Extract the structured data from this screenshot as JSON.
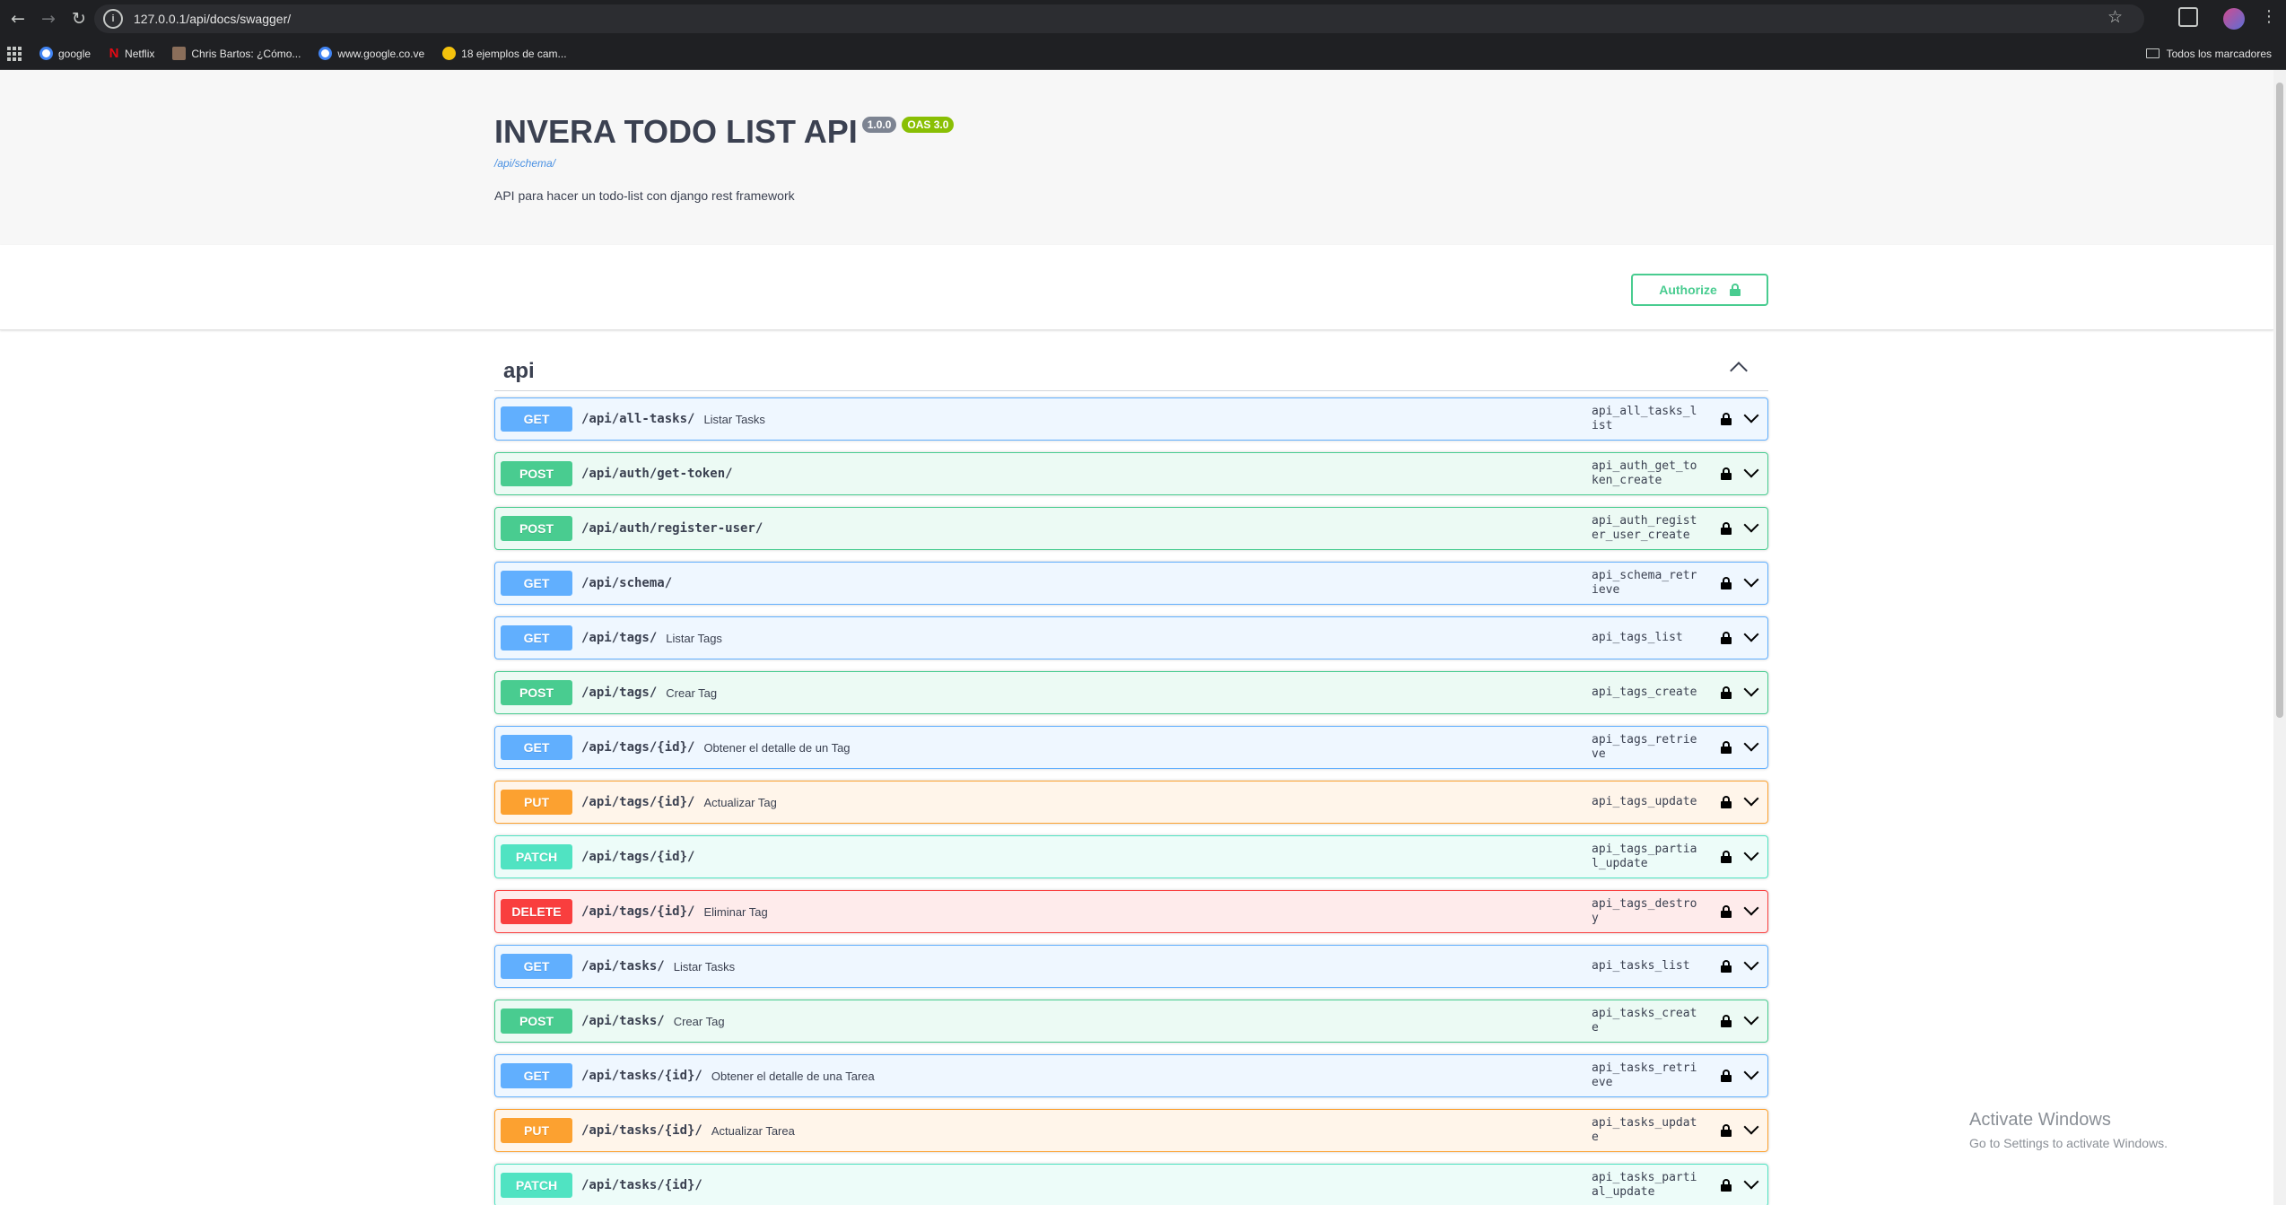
{
  "browser": {
    "url": "127.0.0.1/api/docs/swagger/",
    "bookmarks": [
      {
        "label": "google",
        "icon": "google-icon"
      },
      {
        "label": "Netflix",
        "icon": "netflix-icon"
      },
      {
        "label": "Chris Bartos: ¿Cómo...",
        "icon": "page-icon"
      },
      {
        "label": "www.google.co.ve",
        "icon": "google-icon"
      },
      {
        "label": "18 ejemplos de cam...",
        "icon": "page-icon"
      }
    ],
    "all_bookmarks_label": "Todos los marcadores"
  },
  "info": {
    "title": "INVERA TODO LIST API",
    "version": "1.0.0",
    "oas": "OAS 3.0",
    "schema_link": "/api/schema/",
    "description": "API para hacer un todo-list con django rest framework"
  },
  "authorize_label": "Authorize",
  "tag": {
    "name": "api"
  },
  "operations": [
    {
      "method": "GET",
      "path": "/api/all-tasks/",
      "summary": "Listar Tasks",
      "operation_id": "api_all_tasks_list"
    },
    {
      "method": "POST",
      "path": "/api/auth/get-token/",
      "summary": "",
      "operation_id": "api_auth_get_token_create"
    },
    {
      "method": "POST",
      "path": "/api/auth/register-user/",
      "summary": "",
      "operation_id": "api_auth_register_user_create"
    },
    {
      "method": "GET",
      "path": "/api/schema/",
      "summary": "",
      "operation_id": "api_schema_retrieve"
    },
    {
      "method": "GET",
      "path": "/api/tags/",
      "summary": "Listar Tags",
      "operation_id": "api_tags_list"
    },
    {
      "method": "POST",
      "path": "/api/tags/",
      "summary": "Crear Tag",
      "operation_id": "api_tags_create"
    },
    {
      "method": "GET",
      "path": "/api/tags/{id}/",
      "summary": "Obtener el detalle de un Tag",
      "operation_id": "api_tags_retrieve"
    },
    {
      "method": "PUT",
      "path": "/api/tags/{id}/",
      "summary": "Actualizar Tag",
      "operation_id": "api_tags_update"
    },
    {
      "method": "PATCH",
      "path": "/api/tags/{id}/",
      "summary": "",
      "operation_id": "api_tags_partial_update"
    },
    {
      "method": "DELETE",
      "path": "/api/tags/{id}/",
      "summary": "Eliminar Tag",
      "operation_id": "api_tags_destroy"
    },
    {
      "method": "GET",
      "path": "/api/tasks/",
      "summary": "Listar Tasks",
      "operation_id": "api_tasks_list"
    },
    {
      "method": "POST",
      "path": "/api/tasks/",
      "summary": "Crear Tag",
      "operation_id": "api_tasks_create"
    },
    {
      "method": "GET",
      "path": "/api/tasks/{id}/",
      "summary": "Obtener el detalle de una Tarea",
      "operation_id": "api_tasks_retrieve"
    },
    {
      "method": "PUT",
      "path": "/api/tasks/{id}/",
      "summary": "Actualizar Tarea",
      "operation_id": "api_tasks_update"
    },
    {
      "method": "PATCH",
      "path": "/api/tasks/{id}/",
      "summary": "",
      "operation_id": "api_tasks_partial_update"
    }
  ],
  "method_colors": {
    "GET": "#61affe",
    "POST": "#49cc90",
    "PUT": "#fca130",
    "PATCH": "#50e3c2",
    "DELETE": "#f93e3e"
  },
  "watermark": {
    "title": "Activate Windows",
    "subtitle": "Go to Settings to activate Windows."
  }
}
